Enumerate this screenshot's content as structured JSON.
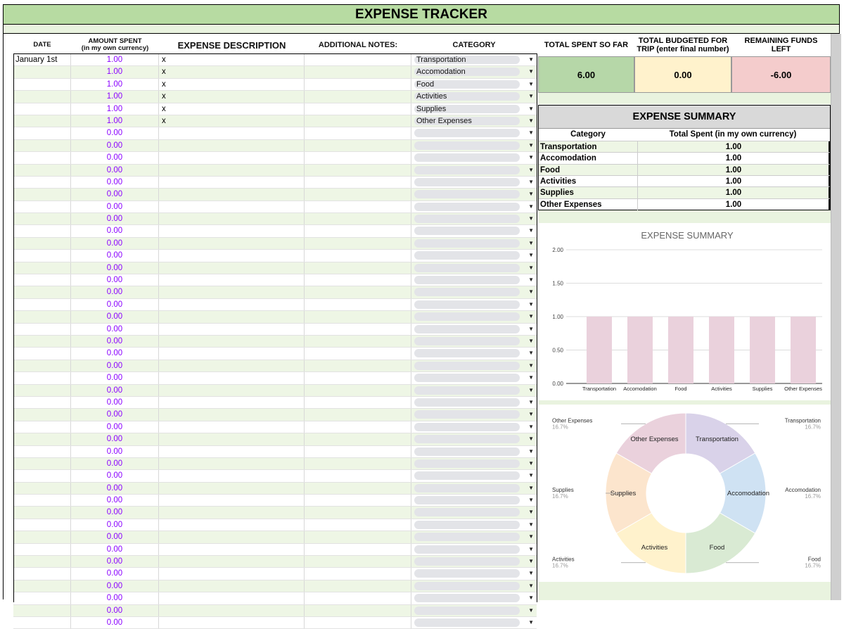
{
  "title": "EXPENSE TRACKER",
  "headers": {
    "date": "DATE",
    "amount_line1": "AMOUNT SPENT",
    "amount_line2": "(in my own currency)",
    "description": "EXPENSE DESCRIPTION",
    "notes": "ADDITIONAL NOTES:",
    "category": "CATEGORY",
    "total_spent": "TOTAL SPENT SO FAR",
    "budget_line1": "TOTAL BUDGETED FOR",
    "budget_line2": "TRIP (enter final number)",
    "remaining_line1": "REMAINING FUNDS",
    "remaining_line2": "LEFT"
  },
  "kpis": {
    "total_spent": "6.00",
    "budgeted": "0.00",
    "remaining": "-6.00",
    "colors": {
      "spent": "#b6d7a8",
      "budget": "#fff2cc",
      "remaining": "#f4cccc"
    }
  },
  "rows": [
    {
      "date": "January 1st",
      "amount": "1.00",
      "desc": "x",
      "category": "Transportation"
    },
    {
      "date": "",
      "amount": "1.00",
      "desc": "x",
      "category": "Accomodation"
    },
    {
      "date": "",
      "amount": "1.00",
      "desc": "x",
      "category": "Food"
    },
    {
      "date": "",
      "amount": "1.00",
      "desc": "x",
      "category": "Activities"
    },
    {
      "date": "",
      "amount": "1.00",
      "desc": "x",
      "category": "Supplies"
    },
    {
      "date": "",
      "amount": "1.00",
      "desc": "x",
      "category": "Other Expenses"
    },
    {
      "date": "",
      "amount": "0.00",
      "desc": "",
      "category": ""
    },
    {
      "date": "",
      "amount": "0.00",
      "desc": "",
      "category": ""
    },
    {
      "date": "",
      "amount": "0.00",
      "desc": "",
      "category": ""
    },
    {
      "date": "",
      "amount": "0.00",
      "desc": "",
      "category": ""
    },
    {
      "date": "",
      "amount": "0.00",
      "desc": "",
      "category": ""
    },
    {
      "date": "",
      "amount": "0.00",
      "desc": "",
      "category": ""
    },
    {
      "date": "",
      "amount": "0.00",
      "desc": "",
      "category": ""
    },
    {
      "date": "",
      "amount": "0.00",
      "desc": "",
      "category": ""
    },
    {
      "date": "",
      "amount": "0.00",
      "desc": "",
      "category": ""
    },
    {
      "date": "",
      "amount": "0.00",
      "desc": "",
      "category": ""
    },
    {
      "date": "",
      "amount": "0.00",
      "desc": "",
      "category": ""
    },
    {
      "date": "",
      "amount": "0.00",
      "desc": "",
      "category": ""
    },
    {
      "date": "",
      "amount": "0.00",
      "desc": "",
      "category": ""
    },
    {
      "date": "",
      "amount": "0.00",
      "desc": "",
      "category": ""
    },
    {
      "date": "",
      "amount": "0.00",
      "desc": "",
      "category": ""
    },
    {
      "date": "",
      "amount": "0.00",
      "desc": "",
      "category": ""
    },
    {
      "date": "",
      "amount": "0.00",
      "desc": "",
      "category": ""
    },
    {
      "date": "",
      "amount": "0.00",
      "desc": "",
      "category": ""
    },
    {
      "date": "",
      "amount": "0.00",
      "desc": "",
      "category": ""
    },
    {
      "date": "",
      "amount": "0.00",
      "desc": "",
      "category": ""
    },
    {
      "date": "",
      "amount": "0.00",
      "desc": "",
      "category": ""
    },
    {
      "date": "",
      "amount": "0.00",
      "desc": "",
      "category": ""
    },
    {
      "date": "",
      "amount": "0.00",
      "desc": "",
      "category": ""
    },
    {
      "date": "",
      "amount": "0.00",
      "desc": "",
      "category": ""
    },
    {
      "date": "",
      "amount": "0.00",
      "desc": "",
      "category": ""
    },
    {
      "date": "",
      "amount": "0.00",
      "desc": "",
      "category": ""
    },
    {
      "date": "",
      "amount": "0.00",
      "desc": "",
      "category": ""
    },
    {
      "date": "",
      "amount": "0.00",
      "desc": "",
      "category": ""
    },
    {
      "date": "",
      "amount": "0.00",
      "desc": "",
      "category": ""
    },
    {
      "date": "",
      "amount": "0.00",
      "desc": "",
      "category": ""
    },
    {
      "date": "",
      "amount": "0.00",
      "desc": "",
      "category": ""
    },
    {
      "date": "",
      "amount": "0.00",
      "desc": "",
      "category": ""
    },
    {
      "date": "",
      "amount": "0.00",
      "desc": "",
      "category": ""
    },
    {
      "date": "",
      "amount": "0.00",
      "desc": "",
      "category": ""
    },
    {
      "date": "",
      "amount": "0.00",
      "desc": "",
      "category": ""
    },
    {
      "date": "",
      "amount": "0.00",
      "desc": "",
      "category": ""
    },
    {
      "date": "",
      "amount": "0.00",
      "desc": "",
      "category": ""
    },
    {
      "date": "",
      "amount": "0.00",
      "desc": "",
      "category": ""
    },
    {
      "date": "",
      "amount": "0.00",
      "desc": "",
      "category": ""
    },
    {
      "date": "",
      "amount": "0.00",
      "desc": "",
      "category": ""
    },
    {
      "date": "",
      "amount": "0.00",
      "desc": "",
      "category": ""
    }
  ],
  "summary": {
    "title": "EXPENSE SUMMARY",
    "col_category": "Category",
    "col_total": "Total Spent (in my own currency)",
    "items": [
      {
        "category": "Transportation",
        "total": "1.00"
      },
      {
        "category": "Accomodation",
        "total": "1.00"
      },
      {
        "category": "Food",
        "total": "1.00"
      },
      {
        "category": "Activities",
        "total": "1.00"
      },
      {
        "category": "Supplies",
        "total": "1.00"
      },
      {
        "category": "Other Expenses",
        "total": "1.00"
      }
    ]
  },
  "icons": {
    "dropdown": "dropdown-arrow-icon"
  },
  "chart_data": [
    {
      "type": "bar",
      "title": "EXPENSE SUMMARY",
      "categories": [
        "Transportation",
        "Accomodation",
        "Food",
        "Activities",
        "Supplies",
        "Other Expenses"
      ],
      "values": [
        1,
        1,
        1,
        1,
        1,
        1
      ],
      "ylim": [
        0,
        2
      ],
      "yticks": [
        "0.00",
        "0.50",
        "1.00",
        "1.50",
        "2.00"
      ],
      "grid": true,
      "bar_color": "#ead1dc"
    },
    {
      "type": "pie",
      "donut": true,
      "categories": [
        "Transportation",
        "Accomodation",
        "Food",
        "Activities",
        "Supplies",
        "Other Expenses"
      ],
      "values": [
        1,
        1,
        1,
        1,
        1,
        1
      ],
      "percent_labels": [
        "16.7%",
        "16.7%",
        "16.7%",
        "16.7%",
        "16.7%",
        "16.7%"
      ],
      "colors": [
        "#d9d2e9",
        "#cfe2f3",
        "#d9ead3",
        "#fff2cc",
        "#fce5cd",
        "#ead1dc"
      ]
    }
  ]
}
